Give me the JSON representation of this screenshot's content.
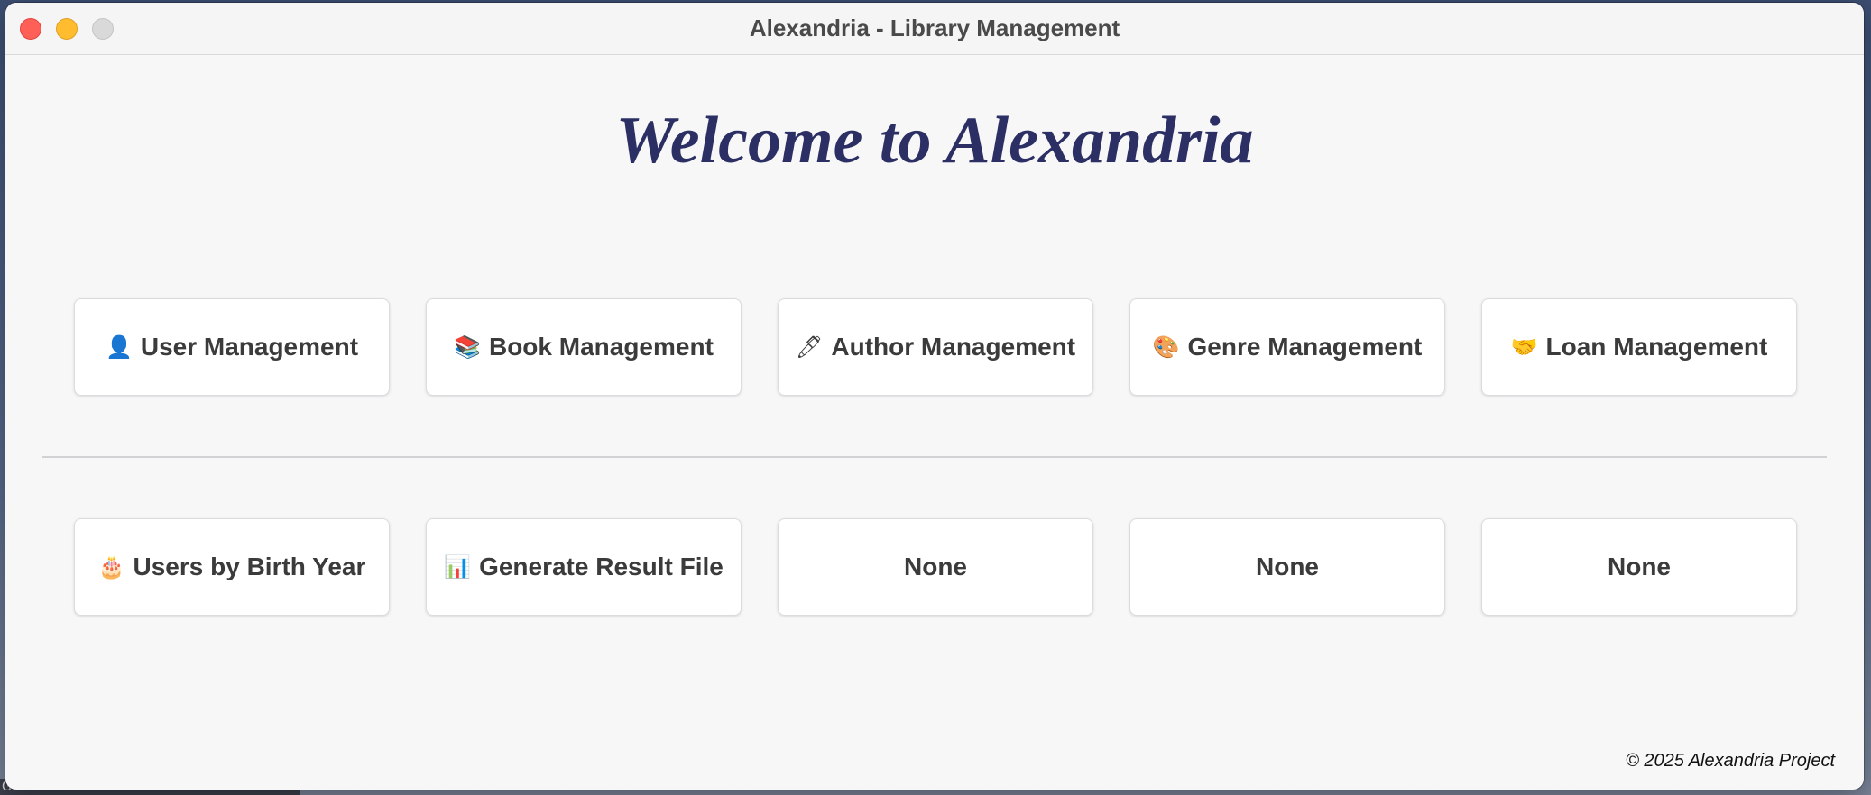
{
  "window": {
    "title": "Alexandria - Library Management"
  },
  "desktop": {
    "partial_label": "Generated Thumbnail"
  },
  "main": {
    "heading": "Welcome to Alexandria",
    "row1": [
      {
        "icon": "👤",
        "icon_name": "user-icon",
        "label": "User Management"
      },
      {
        "icon": "📚",
        "icon_name": "books-icon",
        "label": "Book Management"
      },
      {
        "icon": "🖊",
        "icon_name": "pen-icon",
        "label": "Author Management"
      },
      {
        "icon": "🎨",
        "icon_name": "palette-icon",
        "label": "Genre Management"
      },
      {
        "icon": "🤝",
        "icon_name": "handshake-icon",
        "label": "Loan Management"
      }
    ],
    "row2": [
      {
        "icon": "🎂",
        "icon_name": "birthday-cake-icon",
        "label": "Users by Birth Year"
      },
      {
        "icon": "📊",
        "icon_name": "bar-chart-icon",
        "label": "Generate Result File"
      },
      {
        "icon": "",
        "icon_name": "",
        "label": "None"
      },
      {
        "icon": "",
        "icon_name": "",
        "label": "None"
      },
      {
        "icon": "",
        "icon_name": "",
        "label": "None"
      }
    ]
  },
  "footer": {
    "copyright": "© 2025 Alexandria Project"
  },
  "colors": {
    "heading": "#2b2f63",
    "window_bg": "#f7f7f8",
    "tile_bg": "#ffffff",
    "close": "#fe5f57",
    "minimize": "#febc2e",
    "zoom": "#d9d9d9"
  }
}
